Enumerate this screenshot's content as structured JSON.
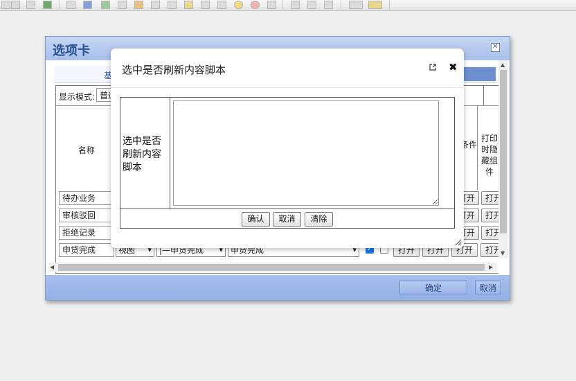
{
  "background_dialog": {
    "title": "选项卡",
    "tab_label": "基",
    "mode_label": "显示模式:",
    "mode_value": "普通",
    "column_name": "名称",
    "column_header_a": "条件",
    "column_header_b": "打印时隐藏组件",
    "rows": [
      {
        "name": "待办业务",
        "buttons": [
          "打开",
          "打开"
        ]
      },
      {
        "name": "审核驳回",
        "buttons": [
          "打开",
          "打开"
        ]
      },
      {
        "name": "拒绝记录",
        "buttons": [
          "打开",
          "打开"
        ]
      },
      {
        "name": "申贷完成",
        "view": "视图",
        "step": "|—申贷完成",
        "value": "申贷完成",
        "check_a": true,
        "check_b": false,
        "buttons": [
          "打开",
          "打开",
          "打开",
          "打开"
        ]
      }
    ],
    "ok_label": "确定",
    "cancel_label": "取消"
  },
  "modal": {
    "title": "选中是否刷新内容脚本",
    "field_label": "选中是否刷新内容脚本",
    "script_value": "",
    "confirm_label": "确认",
    "cancel_label": "取消",
    "clear_label": "清除"
  }
}
